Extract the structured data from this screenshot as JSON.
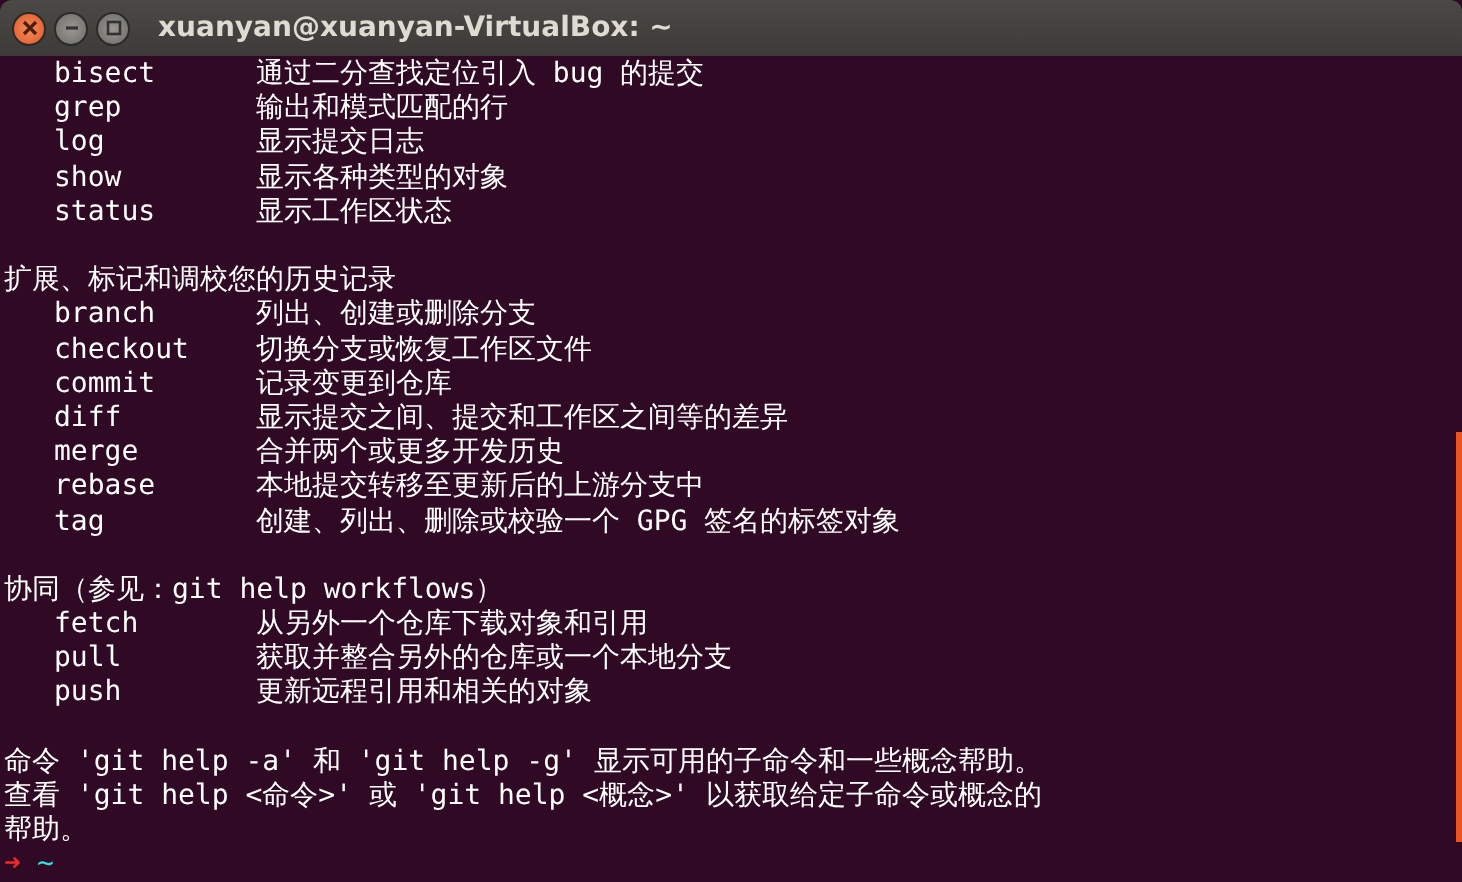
{
  "window": {
    "title": "xuanyan@xuanyan-VirtualBox: ~"
  },
  "groups": [
    {
      "commands": [
        {
          "name": "bisect",
          "description": "通过二分查找定位引入 bug 的提交"
        },
        {
          "name": "grep",
          "description": "输出和模式匹配的行"
        },
        {
          "name": "log",
          "description": "显示提交日志"
        },
        {
          "name": "show",
          "description": "显示各种类型的对象"
        },
        {
          "name": "status",
          "description": "显示工作区状态"
        }
      ]
    },
    {
      "heading": "扩展、标记和调校您的历史记录",
      "commands": [
        {
          "name": "branch",
          "description": "列出、创建或删除分支"
        },
        {
          "name": "checkout",
          "description": "切换分支或恢复工作区文件"
        },
        {
          "name": "commit",
          "description": "记录变更到仓库"
        },
        {
          "name": "diff",
          "description": "显示提交之间、提交和工作区之间等的差异"
        },
        {
          "name": "merge",
          "description": "合并两个或更多开发历史"
        },
        {
          "name": "rebase",
          "description": "本地提交转移至更新后的上游分支中"
        },
        {
          "name": "tag",
          "description": "创建、列出、删除或校验一个 GPG 签名的标签对象"
        }
      ]
    },
    {
      "heading": "协同（参见：git help workflows）",
      "commands": [
        {
          "name": "fetch",
          "description": "从另外一个仓库下载对象和引用"
        },
        {
          "name": "pull",
          "description": "获取并整合另外的仓库或一个本地分支"
        },
        {
          "name": "push",
          "description": "更新远程引用和相关的对象"
        }
      ]
    }
  ],
  "footer": [
    "命令 'git help -a' 和 'git help -g' 显示可用的子命令和一些概念帮助。",
    "查看 'git help <命令>' 或 'git help <概念>' 以获取给定子命令或概念的",
    "帮助。"
  ],
  "prompt": {
    "arrow": "➜",
    "path": "~"
  }
}
